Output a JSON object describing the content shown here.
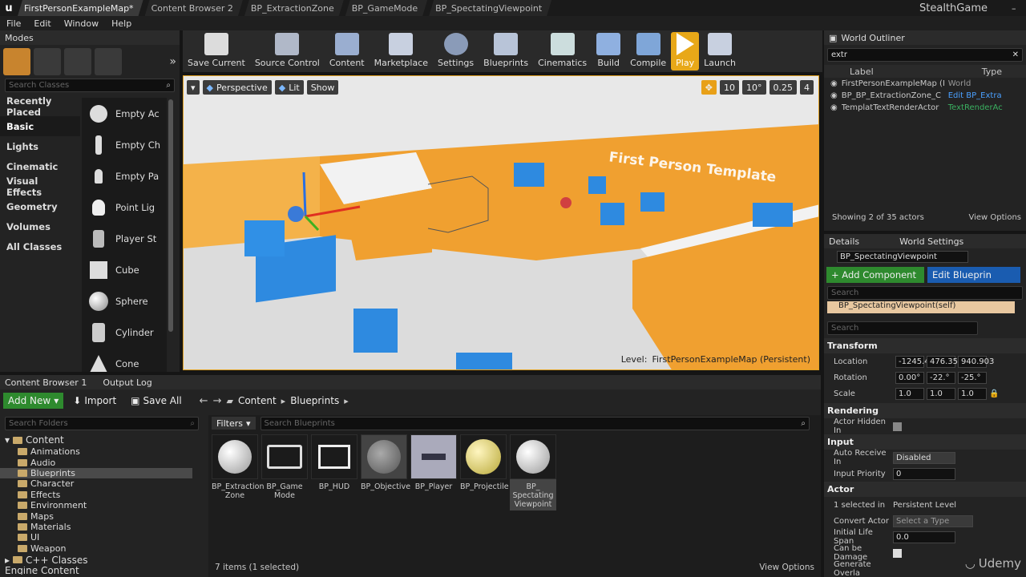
{
  "tabs": [
    "FirstPersonExampleMap*",
    "Content Browser 2",
    "BP_ExtractionZone",
    "BP_GameMode",
    "BP_SpectatingViewpoint"
  ],
  "project_name": "StealthGame",
  "menu": [
    "File",
    "Edit",
    "Window",
    "Help"
  ],
  "modes": {
    "title": "Modes",
    "search_placeholder": "Search Classes",
    "categories": [
      "Recently Placed",
      "Basic",
      "Lights",
      "Cinematic",
      "Visual Effects",
      "Geometry",
      "Volumes",
      "All Classes"
    ],
    "items": [
      "Empty Ac",
      "Empty Ch",
      "Empty Pa",
      "Point Lig",
      "Player St",
      "Cube",
      "Sphere",
      "Cylinder",
      "Cone"
    ]
  },
  "toolbar": [
    "Save Current",
    "Source Control",
    "Content",
    "Marketplace",
    "Settings",
    "Blueprints",
    "Cinematics",
    "Build",
    "Compile",
    "Play",
    "Launch"
  ],
  "viewport": {
    "perspective": "Perspective",
    "lit": "Lit",
    "show": "Show",
    "grid": "10",
    "angle": "10°",
    "scale": "0.25",
    "cam": "4",
    "level_label": "Level:",
    "level_name": "FirstPersonExampleMap (Persistent)",
    "wall_text": "First Person Template"
  },
  "outliner": {
    "title": "World Outliner",
    "search": "extr",
    "col_label": "Label",
    "col_type": "Type",
    "rows": [
      {
        "label": "FirstPersonExampleMap (Ed",
        "type": "World"
      },
      {
        "label": "BP_BP_ExtractionZone_C",
        "type": "Edit BP_Extra"
      },
      {
        "label": "TemplatTextRenderActor",
        "type": "TextRenderAc"
      }
    ],
    "showing": "Showing 2 of 35 actors",
    "view_options": "View Options"
  },
  "details": {
    "tab1": "Details",
    "tab2": "World Settings",
    "name": "BP_SpectatingViewpoint",
    "add_component": "+ Add Component",
    "edit_blueprint": "Edit Blueprin",
    "search": "Search",
    "self": "BP_SpectatingViewpoint(self)",
    "search2": "Search",
    "transform": "Transform",
    "location": "Location",
    "loc": [
      "-1245.4",
      "476.352",
      "940.903"
    ],
    "rotation": "Rotation",
    "rot": [
      "0.00°",
      "-22.°",
      "-25.°"
    ],
    "scale": "Scale",
    "scl": [
      "1.0",
      "1.0",
      "1.0"
    ],
    "rendering": "Rendering",
    "actor_hidden": "Actor Hidden In",
    "input": "Input",
    "auto_receive": "Auto Receive In",
    "auto_value": "Disabled",
    "input_priority": "Input Priority",
    "priority_value": "0",
    "actor": "Actor",
    "selected_in": "1 selected in",
    "persistent": "Persistent Level",
    "convert": "Convert Actor",
    "select_type": "Select a Type",
    "life_span": "Initial Life Span",
    "life_value": "0.0",
    "damaged": "Can be Damage",
    "generate": "Generate Overla"
  },
  "content": {
    "tab1": "Content Browser 1",
    "tab2": "Output Log",
    "add_new": "Add New",
    "import": "Import",
    "save_all": "Save All",
    "crumb1": "Content",
    "crumb2": "Blueprints",
    "search_folders": "Search Folders",
    "filters": "Filters",
    "search_bp": "Search Blueprints",
    "root": "Content",
    "folders": [
      "Animations",
      "Audio",
      "Blueprints",
      "Character",
      "Effects",
      "Environment",
      "Maps",
      "Materials",
      "UI",
      "Weapon"
    ],
    "cpp": "C++ Classes",
    "engine": "Engine Content",
    "assets": [
      "BP_Extraction Zone",
      "BP_Game Mode",
      "BP_HUD",
      "BP_Objective",
      "BP_Player",
      "BP_Projectile",
      "BP_ Spectating Viewpoint"
    ],
    "count": "7 items (1 selected)",
    "view_options": "View Options"
  },
  "watermark": "Udemy"
}
